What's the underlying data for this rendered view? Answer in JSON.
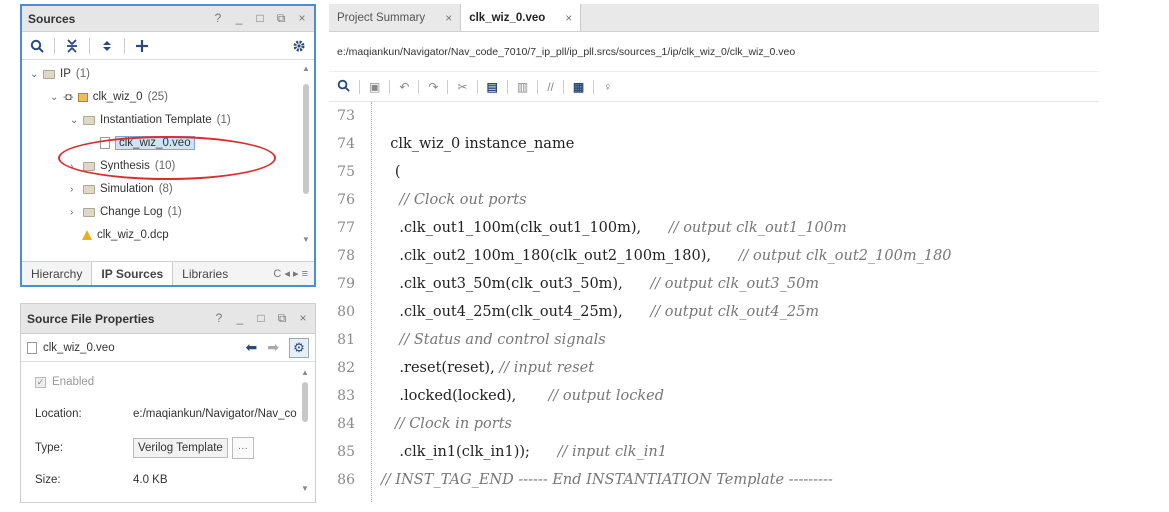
{
  "sources": {
    "title": "Sources",
    "controls": [
      "?",
      "_",
      "□",
      "⧉",
      "×"
    ],
    "tree": {
      "ip": {
        "label": "IP",
        "count": "(1)"
      },
      "clk_wiz": {
        "label": "clk_wiz_0",
        "count": "(25)"
      },
      "inst_template": {
        "label": "Instantiation Template",
        "count": "(1)"
      },
      "veo_file": {
        "label": "clk_wiz_0.veo"
      },
      "synthesis": {
        "label": "Synthesis",
        "count": "(10)"
      },
      "simulation": {
        "label": "Simulation",
        "count": "(8)"
      },
      "change_log": {
        "label": "Change Log",
        "count": "(1)"
      },
      "dcp_file": {
        "label": "clk_wiz_0.dcp"
      }
    },
    "bottom_tabs": [
      "Hierarchy",
      "IP Sources",
      "Libraries"
    ],
    "bottom_nav": "C ◂ ▸ ≡"
  },
  "props": {
    "title": "Source File Properties",
    "controls": [
      "?",
      "_",
      "□",
      "⧉",
      "×"
    ],
    "file_name": "clk_wiz_0.veo",
    "enabled_label": "Enabled",
    "location_label": "Location:",
    "location_value": "e:/maqiankun/Navigator/Nav_co",
    "type_label": "Type:",
    "type_value": "Verilog Template",
    "type_btn": "···",
    "size_label": "Size:",
    "size_value": "4.0 KB"
  },
  "editor": {
    "tabs": [
      {
        "label": "Project Summary",
        "close": "×"
      },
      {
        "label": "clk_wiz_0.veo",
        "close": "×"
      }
    ],
    "path": "e:/maqiankun/Navigator/Nav_code_7010/7_ip_pll/ip_pll.srcs/sources_1/ip/clk_wiz_0/clk_wiz_0.veo",
    "lines": [
      {
        "num": "73",
        "code": "",
        "comment": ""
      },
      {
        "num": "74",
        "code": "  clk_wiz_0 instance_name",
        "comment": ""
      },
      {
        "num": "75",
        "code": "   (",
        "comment": ""
      },
      {
        "num": "76",
        "code": "",
        "comment": "    // Clock out ports"
      },
      {
        "num": "77",
        "code": "    .clk_out1_100m(clk_out1_100m),      ",
        "comment": "// output clk_out1_100m"
      },
      {
        "num": "78",
        "code": "    .clk_out2_100m_180(clk_out2_100m_180),      ",
        "comment": "// output clk_out2_100m_180"
      },
      {
        "num": "79",
        "code": "    .clk_out3_50m(clk_out3_50m),      ",
        "comment": "// output clk_out3_50m"
      },
      {
        "num": "80",
        "code": "    .clk_out4_25m(clk_out4_25m),      ",
        "comment": "// output clk_out4_25m"
      },
      {
        "num": "81",
        "code": "",
        "comment": "    // Status and control signals"
      },
      {
        "num": "82",
        "code": "    .reset(reset), ",
        "comment": "// input reset"
      },
      {
        "num": "83",
        "code": "    .locked(locked),       ",
        "comment": "// output locked"
      },
      {
        "num": "84",
        "code": "",
        "comment": "   // Clock in ports"
      },
      {
        "num": "85",
        "code": "    .clk_in1(clk_in1));      ",
        "comment": "// input clk_in1"
      },
      {
        "num": "86",
        "code": "",
        "comment": "// INST_TAG_END ------ End INSTANTIATION Template ---------"
      }
    ]
  }
}
